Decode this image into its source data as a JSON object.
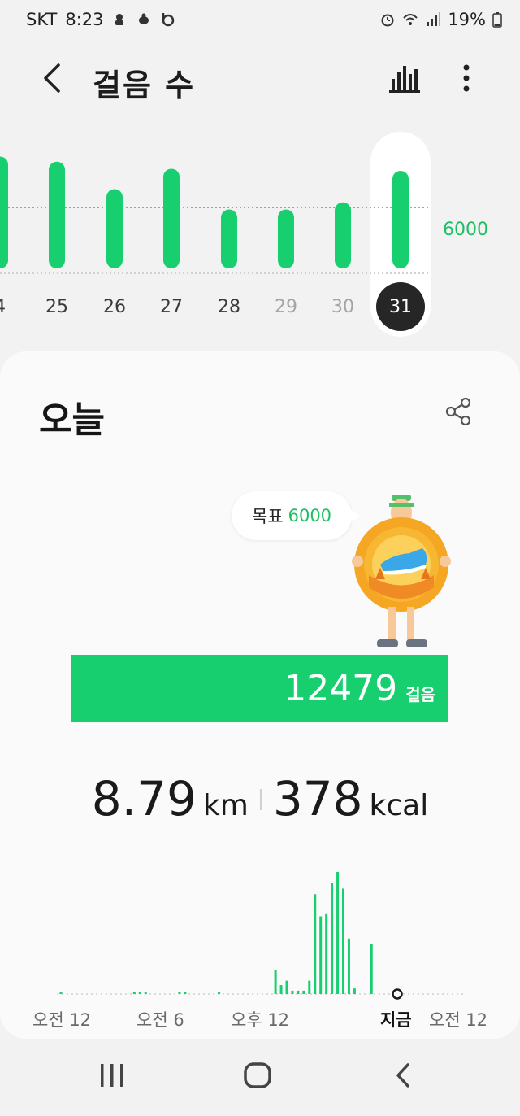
{
  "status_bar": {
    "carrier": "SKT",
    "time": "8:23",
    "battery": "19%"
  },
  "app_bar": {
    "title": "걸음 수",
    "back_icon": "back-chevron-icon",
    "chart_icon": "bar-chart-icon",
    "more_icon": "more-vertical-icon"
  },
  "weekly_chart": {
    "goal_label": "6000",
    "days": [
      {
        "label": "4",
        "dim": false
      },
      {
        "label": "25",
        "dim": false
      },
      {
        "label": "26",
        "dim": false
      },
      {
        "label": "27",
        "dim": false
      },
      {
        "label": "28",
        "dim": false
      },
      {
        "label": "29",
        "dim": true
      },
      {
        "label": "30",
        "dim": true
      }
    ],
    "selected_day": "31"
  },
  "chart_data": {
    "type": "bar",
    "categories": [
      "4",
      "25",
      "26",
      "27",
      "28",
      "29",
      "30",
      "31"
    ],
    "values": [
      11000,
      10500,
      7800,
      9800,
      5800,
      5800,
      6500,
      9600
    ],
    "goal": 6000,
    "ylim": [
      0,
      12000
    ],
    "grid": false,
    "color": "#17cf6e"
  },
  "today_card": {
    "title": "오늘",
    "share_icon": "share-icon",
    "goal_prefix": "목표",
    "goal_value": "6000",
    "steps": "12479",
    "steps_unit": "걸음",
    "progress_fraction": 1.0,
    "distance": "8.79",
    "distance_unit": "km",
    "calories": "378",
    "calories_unit": "kcal"
  },
  "hourly_chart": {
    "labels": [
      "오전 12",
      "오전 6",
      "오후 12",
      "지금",
      "오전 12"
    ],
    "values": [
      1,
      0,
      0,
      0,
      0,
      0,
      0,
      0,
      0,
      0,
      0,
      0,
      0,
      1,
      1,
      1,
      0,
      0,
      0,
      0,
      0,
      1,
      1,
      0,
      0,
      0,
      0,
      0,
      1,
      0,
      0,
      0,
      0,
      0,
      0,
      0,
      0,
      0,
      22,
      8,
      12,
      3,
      3,
      3,
      12,
      90,
      70,
      72,
      100,
      110,
      95,
      50,
      5,
      0,
      0,
      45
    ],
    "color": "#17cf6e"
  },
  "nav_bar": {
    "recent_icon": "recent-apps-icon",
    "home_icon": "home-icon",
    "back_icon": "nav-back-icon"
  }
}
